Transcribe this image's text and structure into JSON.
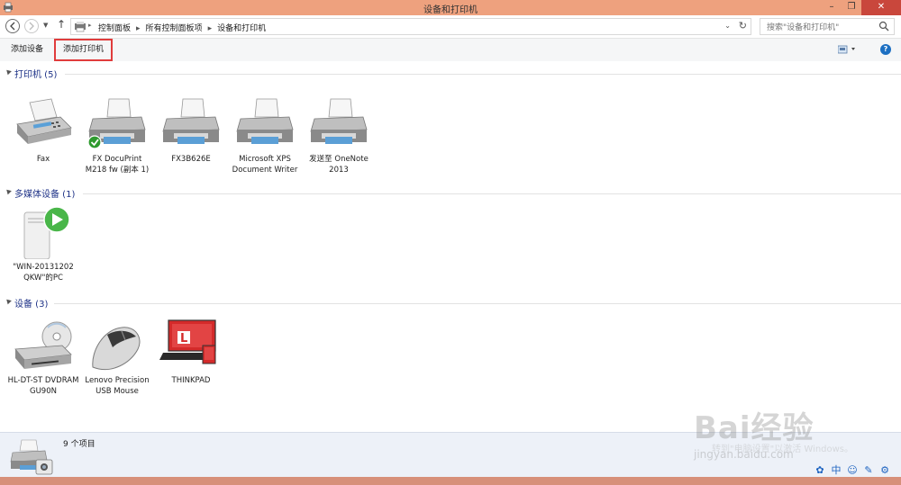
{
  "window": {
    "title": "设备和打印机"
  },
  "address": {
    "breadcrumbs": [
      "控制面板",
      "所有控制面板项",
      "设备和打印机"
    ],
    "search_placeholder": "搜索\"设备和打印机\""
  },
  "toolbar": {
    "add_device": "添加设备",
    "add_printer": "添加打印机"
  },
  "groups": [
    {
      "title": "打印机 (5)",
      "devices": [
        {
          "label": "Fax",
          "icon": "fax-icon"
        },
        {
          "label": "FX DocuPrint M218 fw (副本 1)",
          "icon": "printer-icon",
          "default": true
        },
        {
          "label": "FX3B626E",
          "icon": "printer-icon"
        },
        {
          "label": "Microsoft XPS Document Writer",
          "icon": "printer-icon"
        },
        {
          "label": "发送至 OneNote 2013",
          "icon": "printer-icon"
        }
      ]
    },
    {
      "title": "多媒体设备 (1)",
      "devices": [
        {
          "label": "\"WIN-20131202 QKW\"的PC",
          "icon": "media-pc-icon"
        }
      ]
    },
    {
      "title": "设备 (3)",
      "devices": [
        {
          "label": "HL-DT-ST DVDRAM GU90N",
          "icon": "optical-drive-icon"
        },
        {
          "label": "Lenovo Precision USB Mouse",
          "icon": "mouse-icon"
        },
        {
          "label": "THINKPAD",
          "icon": "laptop-icon"
        }
      ]
    }
  ],
  "status": {
    "count_text": "9 个项目"
  },
  "watermark": {
    "logo": "Bai经验",
    "site": "jingyan.baidu.com",
    "ghost_text": "转到\"电脑设置\"以激活 Windows。"
  },
  "colors": {
    "titlebar": "#eea17e",
    "group_title": "#1e3287",
    "highlight": "#e03c3c"
  }
}
